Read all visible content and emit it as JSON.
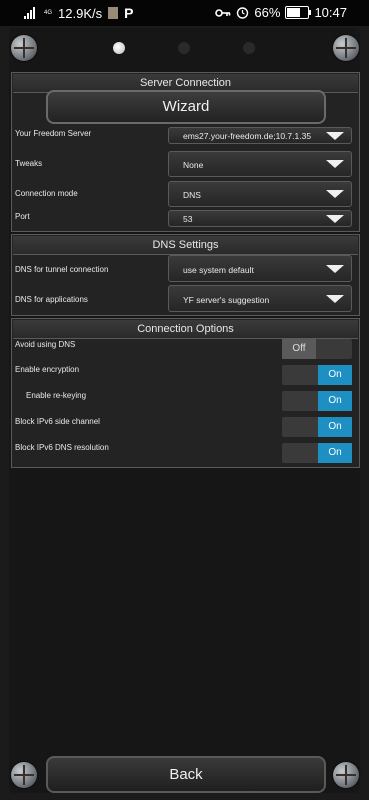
{
  "status_bar": {
    "network_label": "4G",
    "speed": "12.9K/s",
    "app_glyph": "P",
    "battery": "66%",
    "battery_level": 0.66,
    "time": "10:47",
    "icons": [
      "signal-icon",
      "image-icon",
      "key-icon",
      "alarm-icon",
      "battery-icon"
    ]
  },
  "pager": {
    "pages": 3,
    "active_index": 0
  },
  "server_connection": {
    "title": "Server Connection",
    "wizard_label": "Wizard",
    "server": {
      "label": "Your Freedom Server",
      "value": "ems27.your-freedom.de;10.7.1.35"
    },
    "tweaks": {
      "label": "Tweaks",
      "value": "None"
    },
    "mode": {
      "label": "Connection mode",
      "value": "DNS"
    },
    "port": {
      "label": "Port",
      "value": "53"
    }
  },
  "dns_settings": {
    "title": "DNS Settings",
    "tunnel": {
      "label": "DNS for tunnel connection",
      "value": "use system default"
    },
    "apps": {
      "label": "DNS for applications",
      "value": "YF server's suggestion"
    }
  },
  "connection_options": {
    "title": "Connection Options",
    "avoid_dns": {
      "label": "Avoid using DNS",
      "state": "Off"
    },
    "encryption": {
      "label": "Enable encryption",
      "state": "On"
    },
    "rekeying": {
      "label": "Enable re-keying",
      "state": "On"
    },
    "block_side": {
      "label": "Block IPv6 side channel",
      "state": "On"
    },
    "block_dns": {
      "label": "Block IPv6 DNS resolution",
      "state": "On"
    }
  },
  "back_label": "Back",
  "colors": {
    "toggle_on": "#1e8fc3",
    "toggle_off": "#5a5a5a",
    "background": "#1b1b1b"
  }
}
